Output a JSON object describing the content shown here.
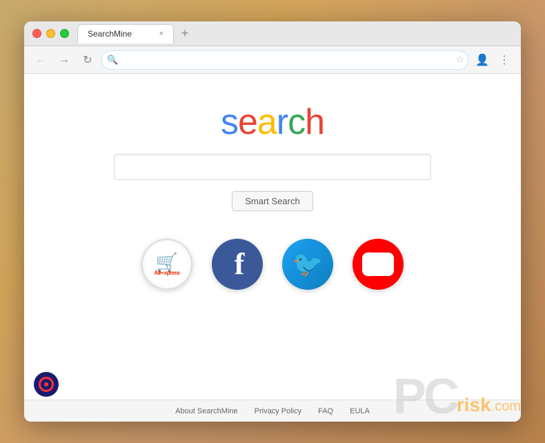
{
  "browser": {
    "tab_title": "SearchMine",
    "tab_close": "×",
    "new_tab": "+",
    "address_bar_value": "",
    "address_placeholder": ""
  },
  "page": {
    "logo_letters": [
      "s",
      "e",
      "a",
      "r",
      "c",
      "h"
    ],
    "search_placeholder": "",
    "smart_search_label": "Smart Search",
    "shortcuts": [
      {
        "id": "aliexpress",
        "label": "AliExpress"
      },
      {
        "id": "facebook",
        "label": "Facebook"
      },
      {
        "id": "twitter",
        "label": "Twitter"
      },
      {
        "id": "youtube",
        "label": "YouTube"
      }
    ],
    "footer_links": [
      "About SearchMine",
      "Privacy Policy",
      "FAQ",
      "EULA"
    ]
  },
  "watermark": {
    "pc": "PC",
    "risk": "risk",
    "com": ".com"
  }
}
